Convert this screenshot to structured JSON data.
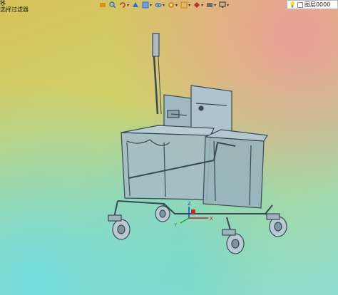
{
  "status": {
    "line1": "移",
    "line2": "选择过滤器"
  },
  "toolbar": {
    "icons": [
      "orient-icon",
      "zoom-area-icon",
      "rotate-icon",
      "section-view-icon",
      "display-style-icon",
      "hide-show-icon",
      "appearance-icon",
      "scene-icon",
      "view-settings-icon",
      "render-icon",
      "monitor-icon"
    ],
    "colors": {
      "orange": "#e08a1a",
      "blue": "#2a6fd6",
      "red": "#cc2b2b",
      "gray": "#6b6b6b"
    }
  },
  "layer": {
    "label": "图层0000"
  },
  "model": {
    "stroke_color": "#3a4a55",
    "fill_color": "#9fb8c2"
  },
  "triad": {
    "x_label": "X",
    "y_label": "Y",
    "z_label": "Z"
  }
}
